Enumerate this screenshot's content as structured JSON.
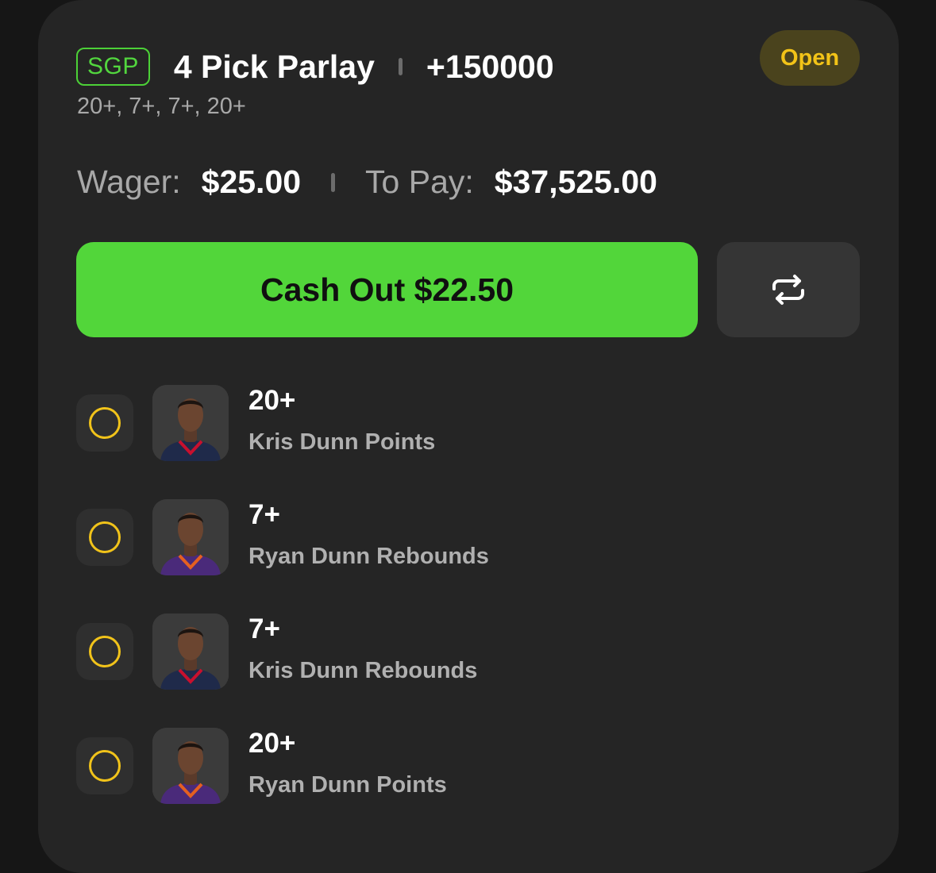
{
  "bet": {
    "badge": "SGP",
    "title": "4 Pick Parlay",
    "odds": "+150000",
    "summary": "20+, 7+, 7+, 20+",
    "status": "Open"
  },
  "amounts": {
    "wager_label": "Wager:",
    "wager_value": "$25.00",
    "pay_label": "To Pay:",
    "pay_value": "$37,525.00"
  },
  "actions": {
    "cashout_label": "Cash Out $22.50",
    "swap_icon": "repeat-arrows-icon"
  },
  "legs": [
    {
      "line": "20+",
      "desc": "Kris Dunn Points",
      "jersey": "#1f2a4a",
      "trim": "#c8102e"
    },
    {
      "line": "7+",
      "desc": "Ryan Dunn Rebounds",
      "jersey": "#4a2a7a",
      "trim": "#e56020"
    },
    {
      "line": "7+",
      "desc": "Kris Dunn Rebounds",
      "jersey": "#1f2a4a",
      "trim": "#c8102e"
    },
    {
      "line": "20+",
      "desc": "Ryan Dunn Points",
      "jersey": "#4a2a7a",
      "trim": "#e56020"
    }
  ],
  "colors": {
    "accent_green": "#52d63a",
    "status_yellow": "#f2c318"
  }
}
